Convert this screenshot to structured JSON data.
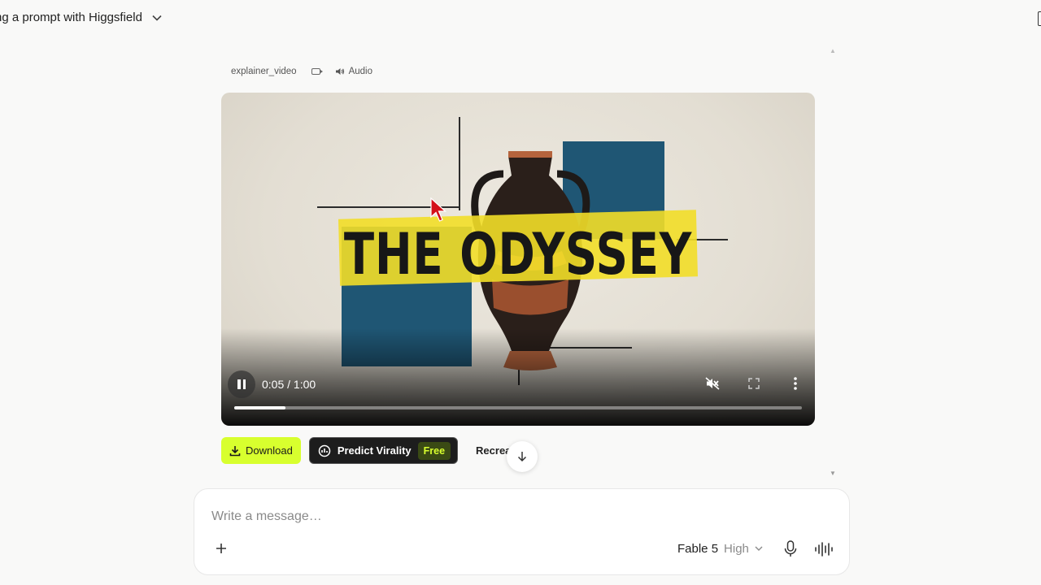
{
  "header": {
    "title": "ng a prompt with Higgsfield"
  },
  "attachment_meta": {
    "filename": "explainer_video",
    "audio_label": "Audio"
  },
  "video": {
    "poster_title": "THE ODYSSEY",
    "time_display": "0:05 / 1:00",
    "progress_fraction": 0.09,
    "muted": true
  },
  "actions": {
    "download_label": "Download",
    "predict_label": "Predict Virality",
    "free_badge": "Free",
    "recreate_label": "Recreate"
  },
  "composer": {
    "placeholder": "Write a message…",
    "model_name": "Fable 5",
    "quality": "High"
  },
  "colors": {
    "accent": "#d8ff2e",
    "predict_bg": "#1d1d1d",
    "poster_blue": "#1f5674",
    "poster_yellow": "#f2de28"
  }
}
